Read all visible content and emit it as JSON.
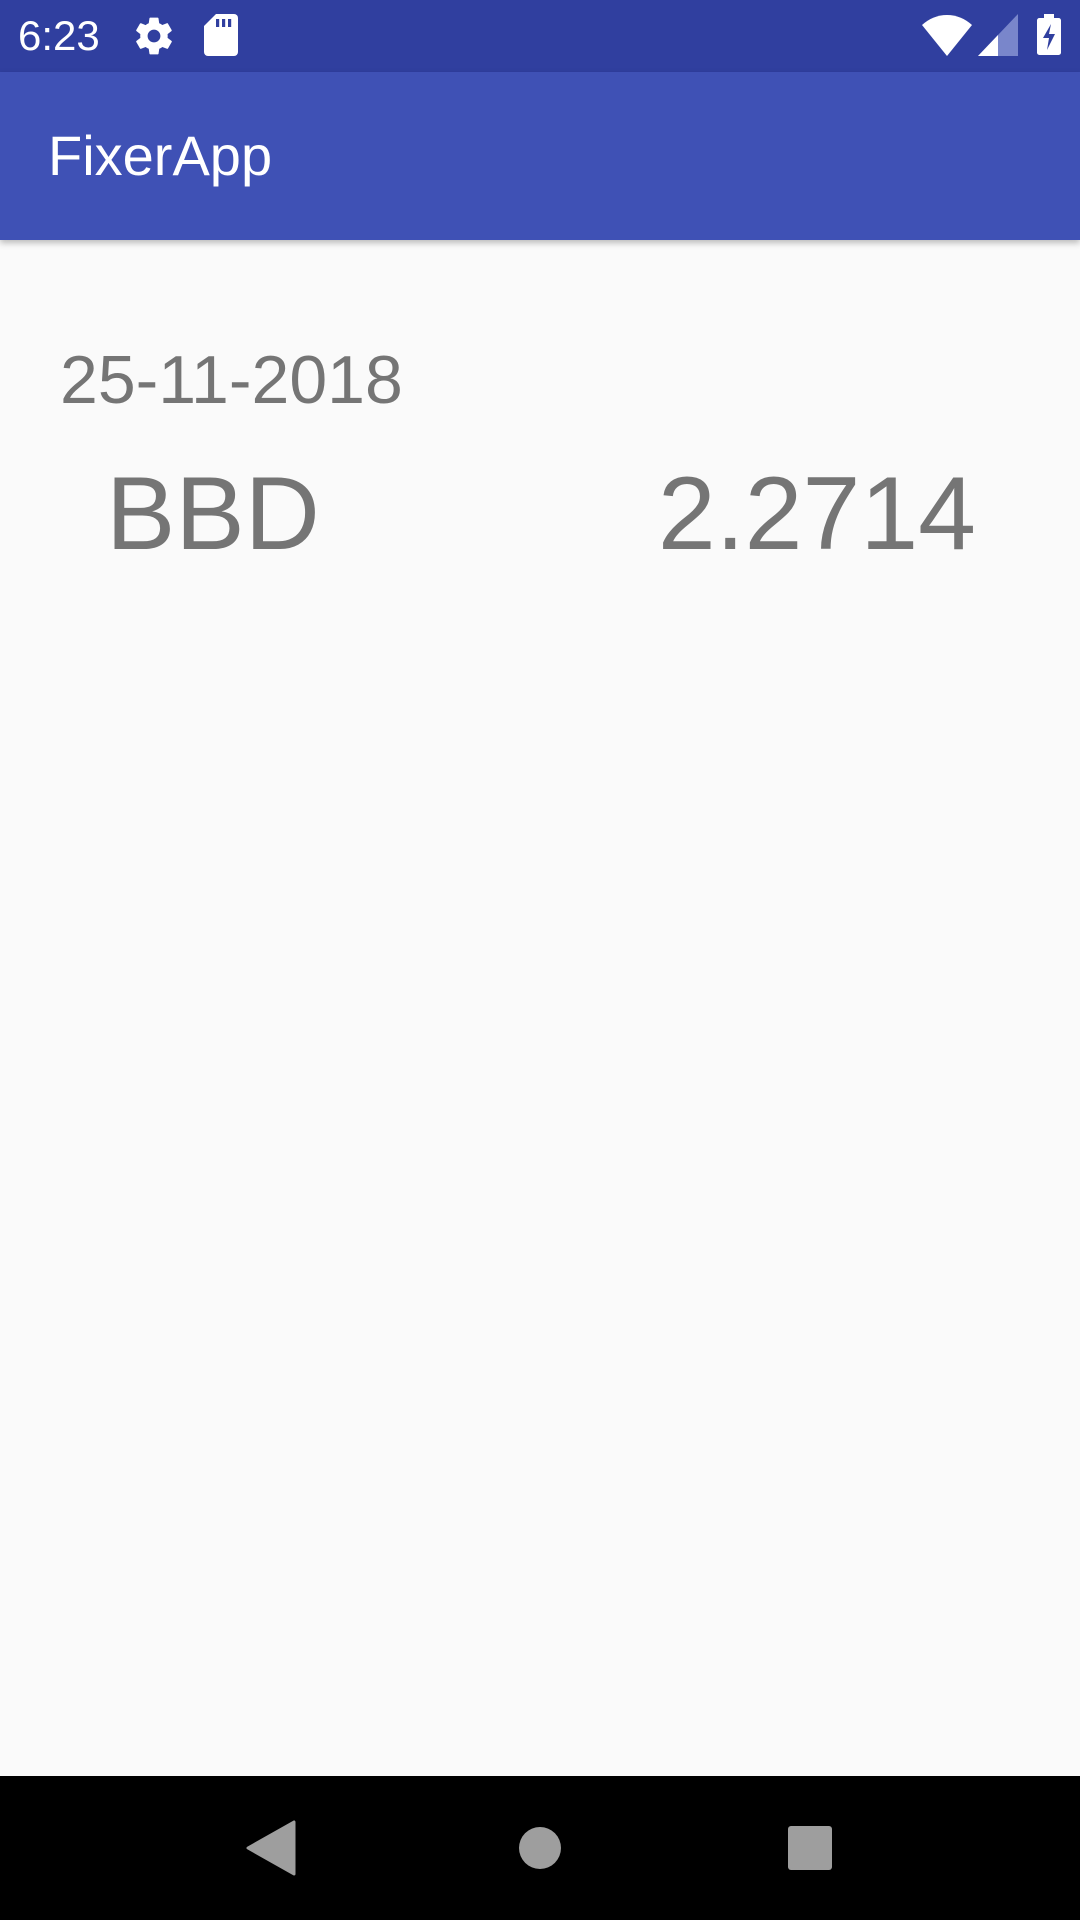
{
  "status_bar": {
    "time": "6:23",
    "icons": [
      "gear-icon",
      "sd-card-icon",
      "wifi-icon",
      "signal-icon",
      "battery-charging-icon"
    ],
    "background_color": "#303f9f"
  },
  "app_bar": {
    "title": "FixerApp",
    "background_color": "#3f51b5"
  },
  "content": {
    "date": "25-11-2018",
    "rates": [
      {
        "code": "BBD",
        "value": "2.2714"
      }
    ],
    "text_color": "#757575"
  },
  "nav_bar": {
    "buttons": [
      "back-icon",
      "home-icon",
      "recents-icon"
    ]
  }
}
